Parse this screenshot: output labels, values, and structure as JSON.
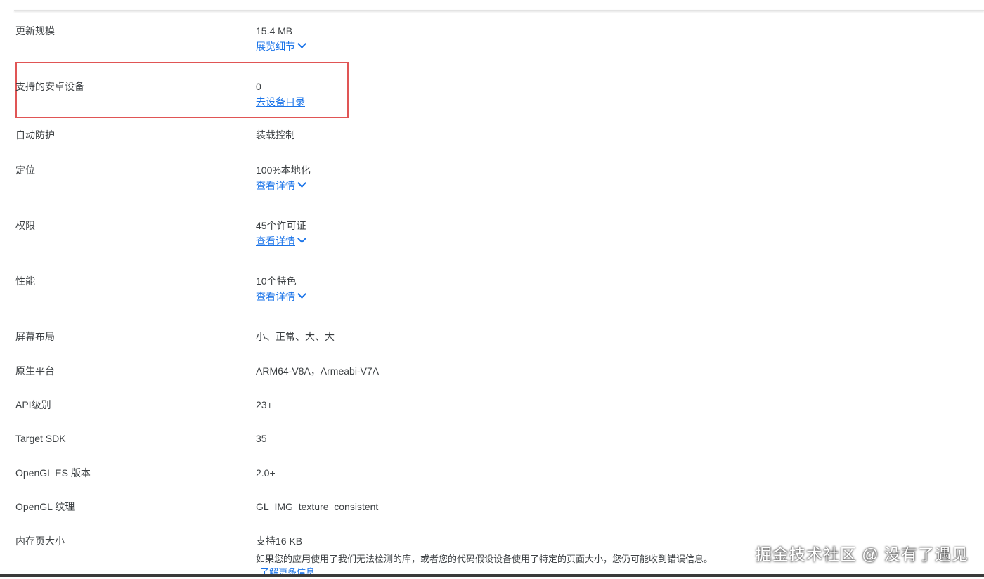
{
  "rows": [
    {
      "label": "更新规模",
      "value": "15.4 MB",
      "link": "展览细节"
    },
    {
      "label": "支持的安卓设备",
      "value": "0",
      "link": "去设备目录"
    },
    {
      "label": "自动防护",
      "value": "装载控制"
    },
    {
      "label": "定位",
      "value": "100%本地化",
      "link": "查看详情"
    },
    {
      "label": "权限",
      "value": "45个许可证",
      "link": "查看详情"
    },
    {
      "label": "性能",
      "value": "10个特色",
      "link": "查看详情"
    },
    {
      "label": "屏幕布局",
      "value": "小、正常、大、大"
    },
    {
      "label": "原生平台",
      "value": "ARM64-V8A，Armeabi-V7A"
    },
    {
      "label": "API级别",
      "value": "23+"
    },
    {
      "label": "Target SDK",
      "value": "35"
    },
    {
      "label": "OpenGL ES 版本",
      "value": "2.0+"
    },
    {
      "label": "OpenGL 纹理",
      "value": "GL_IMG_texture_consistent"
    },
    {
      "label": "内存页大小",
      "value": "支持16 KB",
      "note": "如果您的应用使用了我们无法检测的库，或者您的代码假设设备使用了特定的页面大小，您仍可能收到错误信息。",
      "note_link": "了解更多信息"
    }
  ],
  "highlight_color": "#e05555",
  "link_color": "#1a73e8",
  "watermark": "掘金技术社区 @ 没有了遇见"
}
